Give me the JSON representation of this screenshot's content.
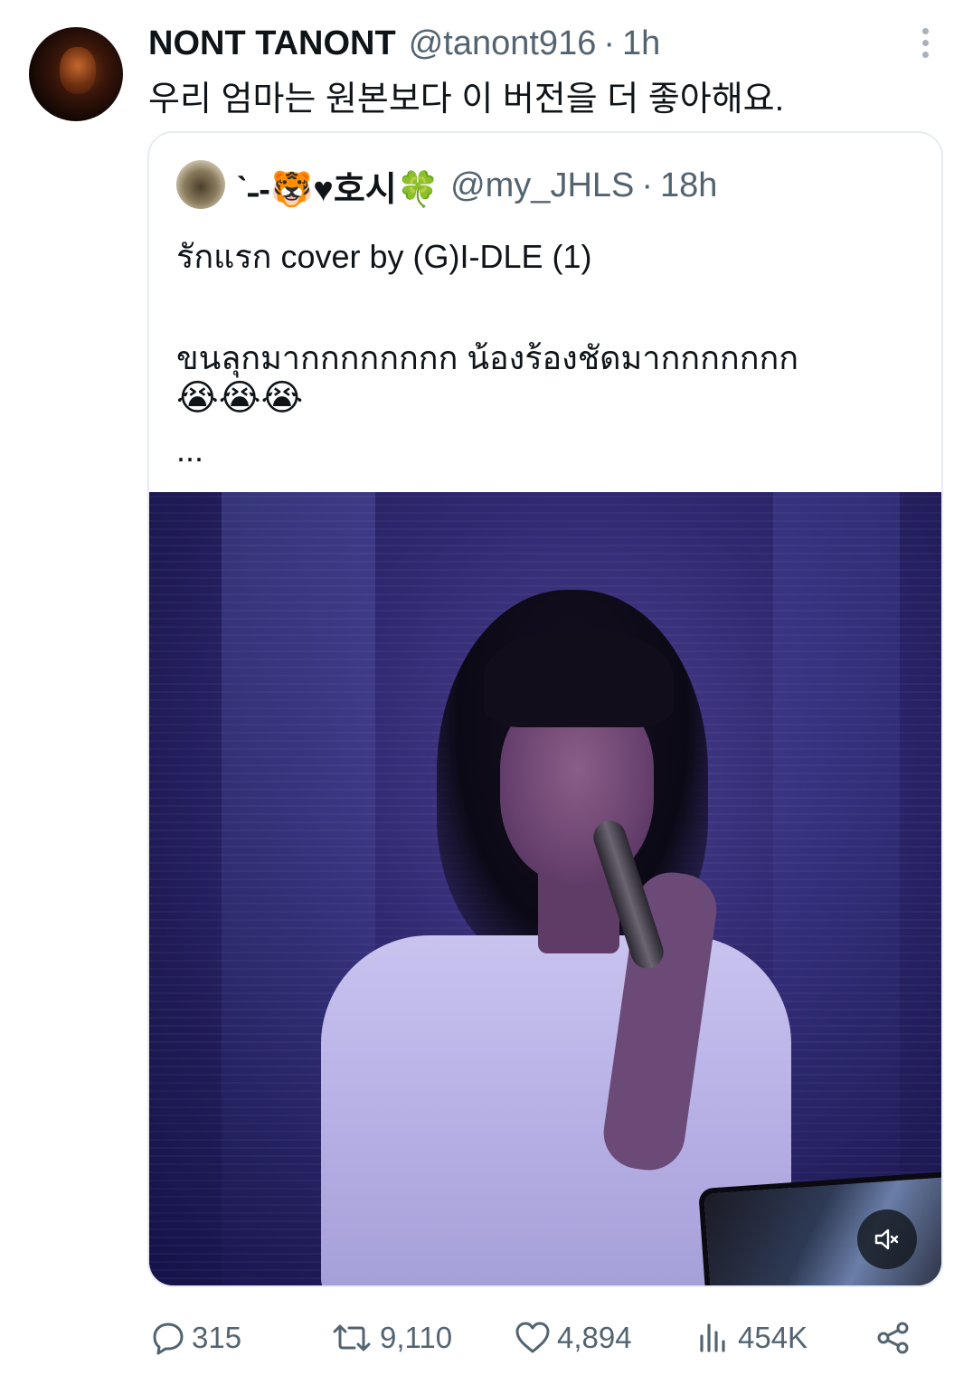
{
  "tweet": {
    "display_name": "NONT TANONT",
    "handle": "@tanont916",
    "separator": "·",
    "time": "1h",
    "text": "우리 엄마는 원본보다 이 버전을 더 좋아해요."
  },
  "quoted_tweet": {
    "display_name": "ˋ˗-🐯♥호시🍀",
    "handle": "@my_JHLS",
    "separator": "·",
    "time": "18h",
    "line1": "รักแรก cover by  (G)I-DLE  (1)",
    "line2": "ขนลุกมากกกกกกกก น้องร้องชัดมากกกกกกก",
    "line3": "😭😭😭",
    "line4": "...",
    "media": {
      "type": "video",
      "muted": true,
      "mute_icon": "speaker-muted-icon"
    }
  },
  "actions": {
    "reply": {
      "icon": "reply-icon",
      "count": "315"
    },
    "retweet": {
      "icon": "retweet-icon",
      "count": "9,110"
    },
    "like": {
      "icon": "heart-icon",
      "count": "4,894"
    },
    "views": {
      "icon": "views-icon",
      "count": "454K"
    },
    "share": {
      "icon": "share-icon"
    }
  },
  "colors": {
    "text_primary": "#0f1419",
    "text_secondary": "#536471",
    "border": "#e6ecf0",
    "background": "#ffffff"
  }
}
